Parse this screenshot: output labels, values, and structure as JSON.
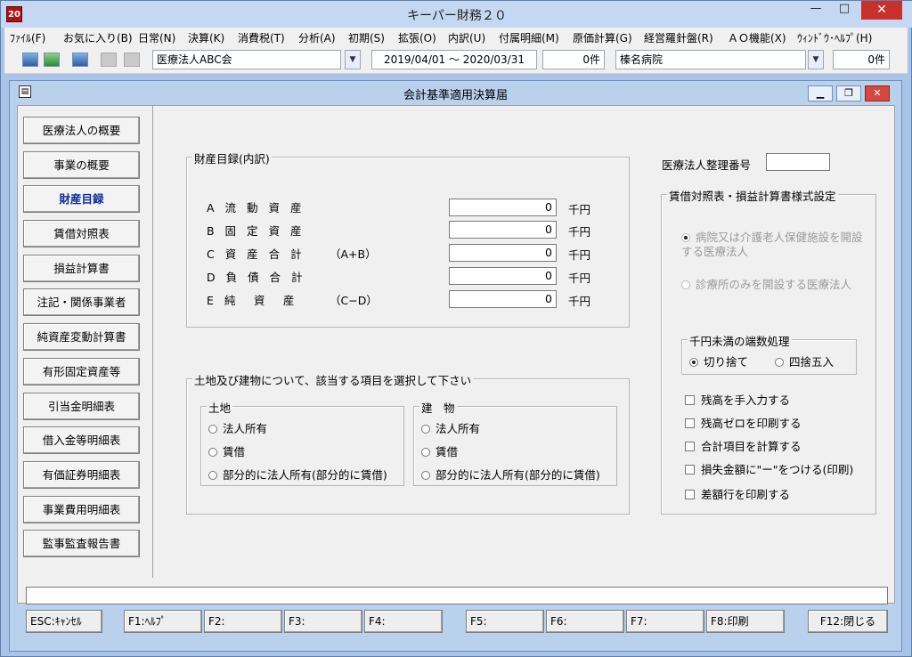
{
  "app": {
    "title": "キーパー財務２０",
    "icon_text": "20"
  },
  "window_buttons": {
    "minimize": "—",
    "maximize": "□",
    "close": "✕"
  },
  "menu": [
    {
      "label": "ﾌｧｲﾙ(F)"
    },
    {
      "label": "お気に入り(B)"
    },
    {
      "label": "日常(N)"
    },
    {
      "label": "決算(K)"
    },
    {
      "label": "消費税(T)"
    },
    {
      "label": "分析(A)"
    },
    {
      "label": "初期(S)"
    },
    {
      "label": "拡張(O)"
    },
    {
      "label": "内訳(U)"
    },
    {
      "label": "付属明細(M)"
    },
    {
      "label": "原価計算(G)"
    },
    {
      "label": "経営羅針盤(R)"
    },
    {
      "label": "ＡＯ機能(X)"
    },
    {
      "label": "ｳｨﾝﾄﾞｳ･ﾍﾙﾌﾟ(H)"
    }
  ],
  "toolbar": {
    "company": "医療法人ABC会",
    "period": "2019/04/01 〜 2020/03/31",
    "count1": "0件",
    "facility": "榛名病院",
    "count2": "0件"
  },
  "form": {
    "title": "会計基準適用決算届",
    "window_buttons": {
      "minimize": "▁",
      "restore": "❐",
      "close": "✕"
    },
    "nav": [
      {
        "label": "医療法人の概要"
      },
      {
        "label": "事業の概要"
      },
      {
        "label": "財産目録"
      },
      {
        "label": "賃借対照表"
      },
      {
        "label": "損益計算書"
      },
      {
        "label": "注記・関係事業者"
      },
      {
        "label": "純資産変動計算書"
      },
      {
        "label": "有形固定資産等"
      },
      {
        "label": "引当金明細表"
      },
      {
        "label": "借入金等明細表"
      },
      {
        "label": "有価証券明細表"
      },
      {
        "label": "事業費用明細表"
      },
      {
        "label": "監事監査報告書"
      }
    ],
    "active_nav": "財産目録",
    "assets": {
      "group_label": "財産目録(内訳)",
      "unit": "千円",
      "rows": [
        {
          "label": "A 流 動 資 産",
          "formula": "",
          "value": "0"
        },
        {
          "label": "B 固 定 資 産",
          "formula": "",
          "value": "0"
        },
        {
          "label": "C 資 産 合 計",
          "formula": "（A+B）",
          "value": "0"
        },
        {
          "label": "D 負 債 合 計",
          "formula": "",
          "value": "0"
        },
        {
          "label": "E 純　資　産",
          "formula": "（C−D）",
          "value": "0"
        }
      ]
    },
    "land_building": {
      "group_label": "土地及び建物について、該当する項目を選択して下さい",
      "land": {
        "label": "土地",
        "options": [
          "法人所有",
          "賃借",
          "部分的に法人所有(部分的に賃借)"
        ]
      },
      "building": {
        "label": "建　物",
        "options": [
          "法人所有",
          "賃借",
          "部分的に法人所有(部分的に賃借)"
        ]
      }
    },
    "reg_number": {
      "label": "医療法人整理番号",
      "value": ""
    },
    "format": {
      "group_label": "賃借対照表・損益計算書様式設定",
      "options": [
        "病院又は介護老人保健施設を開設する医療法人",
        "診療所のみを開設する医療法人"
      ],
      "selected": 0
    },
    "rounding": {
      "group_label": "千円未満の端数処理",
      "options": [
        "切り捨て",
        "四捨五入"
      ],
      "selected": 0
    },
    "checks": [
      {
        "label": "残高を手入力する",
        "checked": false
      },
      {
        "label": "残高ゼロを印刷する",
        "checked": false
      },
      {
        "label": "合計項目を計算する",
        "checked": false
      },
      {
        "label": "損失金額に\"ー\"をつける(印刷)",
        "checked": false
      },
      {
        "label": "差額行を印刷する",
        "checked": false
      }
    ],
    "status_text": "",
    "fkeys": [
      "ESC:ｷｬﾝｾﾙ",
      "F1:ﾍﾙﾌﾟ",
      "F2:",
      "F3:",
      "F4:",
      "F5:",
      "F6:",
      "F7:",
      "F8:印刷",
      "F12:閉じる"
    ]
  }
}
